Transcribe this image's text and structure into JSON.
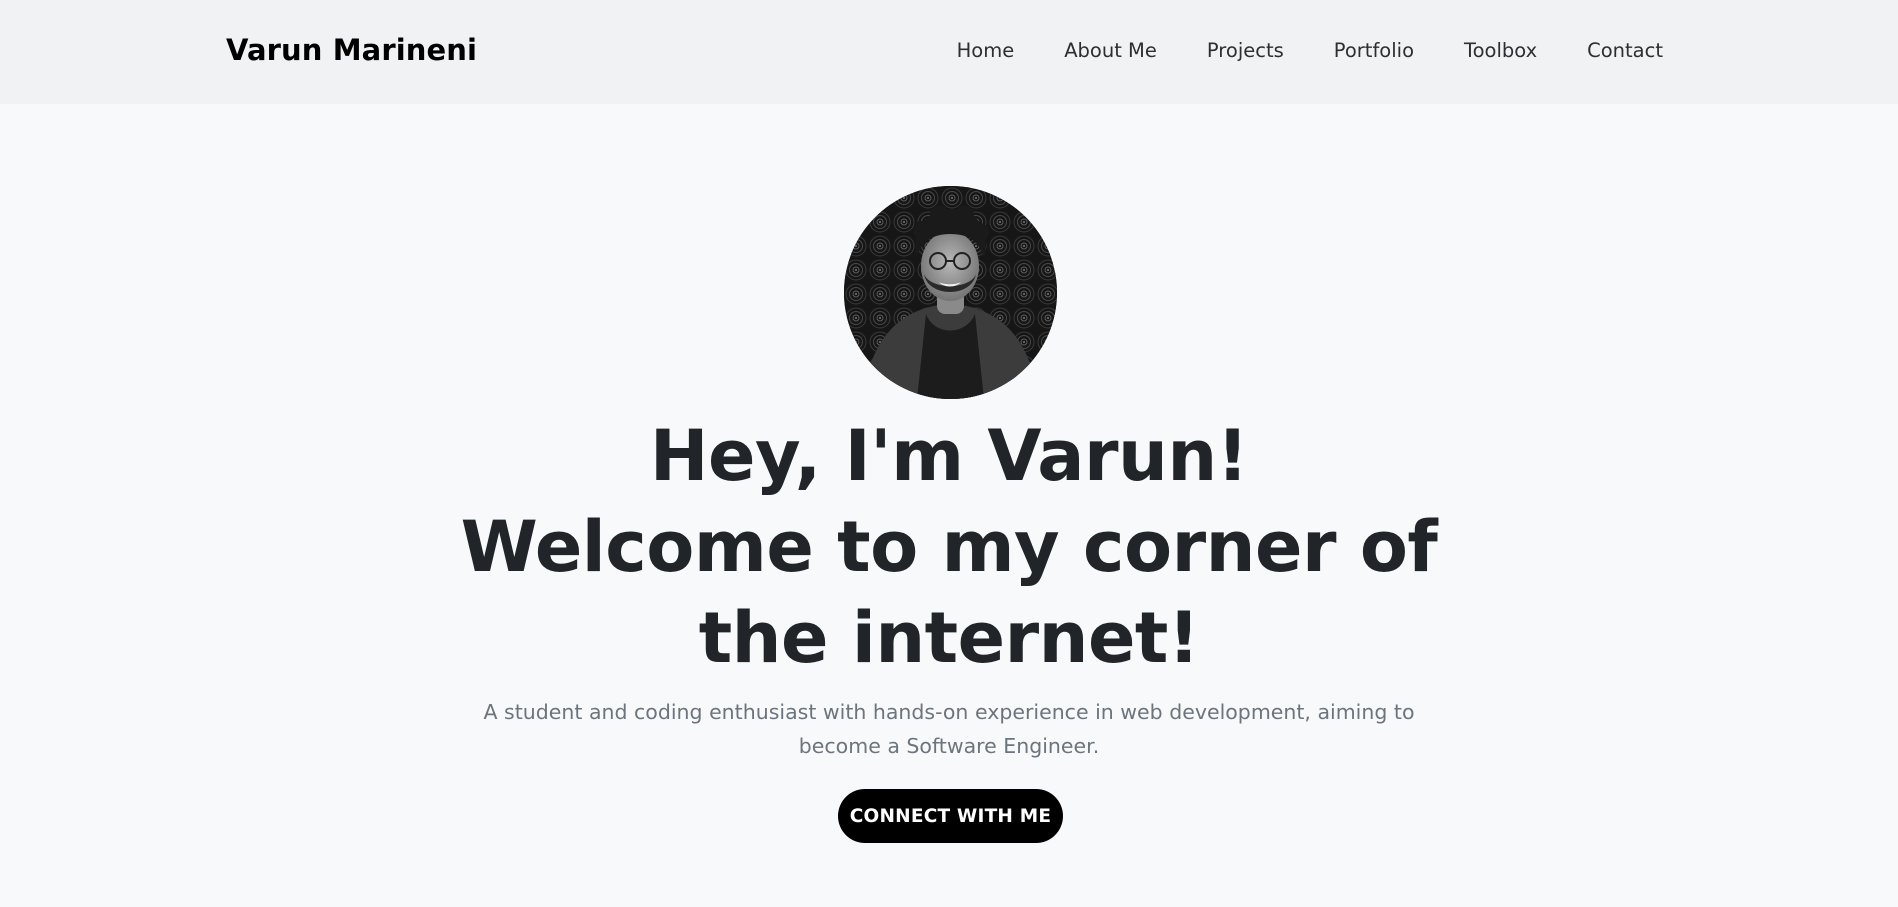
{
  "nav": {
    "brand": "Varun Marineni",
    "links": [
      "Home",
      "About Me",
      "Projects",
      "Portfolio",
      "Toolbox",
      "Contact"
    ]
  },
  "hero": {
    "headline_lines": [
      "Hey, I'm Varun!",
      "Welcome to my corner of",
      "the internet!"
    ],
    "subtext": "A student and coding enthusiast with hands-on experience in web development, aiming to become a Software Engineer.",
    "cta_label": "CONNECT WITH ME"
  },
  "colors": {
    "page_background": "#f8f9fa",
    "navbar_background": "#f1f2f3",
    "cta_background": "#000000",
    "headline": "#212529",
    "subtext": "#6c757d"
  }
}
